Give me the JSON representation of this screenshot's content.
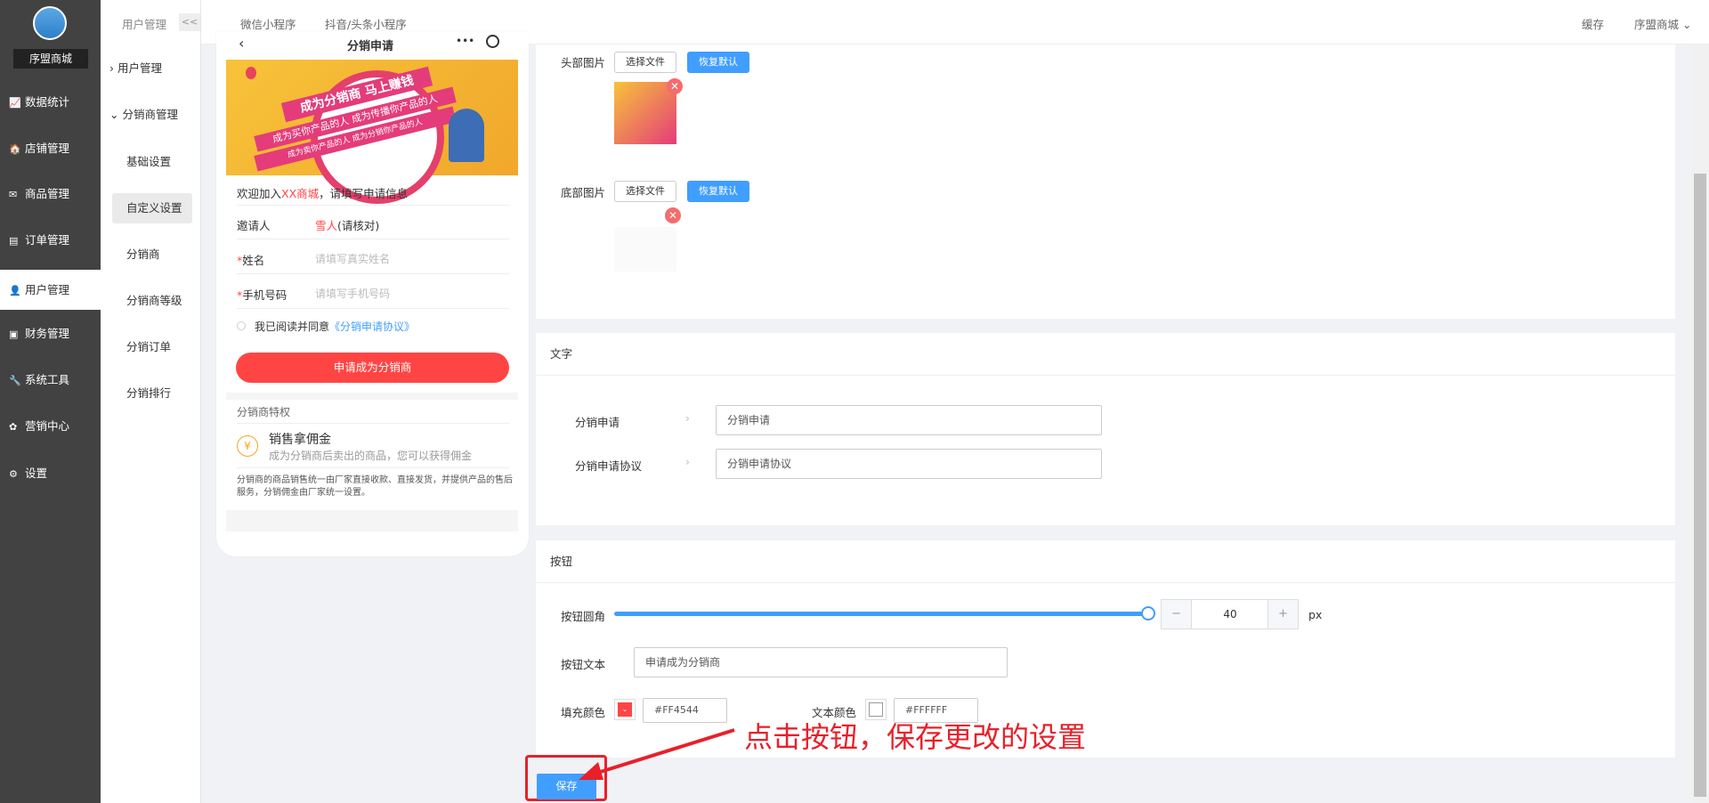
{
  "shop": {
    "name": "序盟商城"
  },
  "menu": [
    {
      "icon": "📈",
      "label": "数据统计"
    },
    {
      "icon": "🏠",
      "label": "店铺管理"
    },
    {
      "icon": "✉",
      "label": "商品管理"
    },
    {
      "icon": "▤",
      "label": "订单管理"
    },
    {
      "icon": "👤",
      "label": "用户管理"
    },
    {
      "icon": "▣",
      "label": "财务管理"
    },
    {
      "icon": "🔧",
      "label": "系统工具"
    },
    {
      "icon": "✿",
      "label": "营销中心"
    },
    {
      "icon": "⚙",
      "label": "设置"
    }
  ],
  "submenu": {
    "header": "用户管理",
    "collapse": "<<",
    "groups": [
      {
        "label": "用户管理"
      },
      {
        "label": "分销商管理"
      }
    ],
    "items": [
      "基础设置",
      "自定义设置",
      "分销商",
      "分销商等级",
      "分销订单",
      "分销排行"
    ]
  },
  "topbar": {
    "tabs": [
      "微信小程序",
      "抖音/头条小程序"
    ],
    "cache": "缓存",
    "shop": "序盟商城"
  },
  "phone": {
    "title": "分销申请",
    "banner_big": "成为分销商 马上赚钱",
    "ribbon1": "成为买你产品的人 成为传播你产品的人",
    "ribbon2": "成为卖你产品的人 成为分销你产品的人",
    "welcome_pre": "欢迎加入",
    "welcome_shop": "XX商城",
    "welcome_post": "，请填写申请信息",
    "inviter_label": "邀请人",
    "inviter_value": "雪人",
    "inviter_note": "(请核对)",
    "name_label": "姓名",
    "name_ph": "请填写真实姓名",
    "phone_label": "手机号码",
    "phone_ph": "请填写手机号码",
    "agree": "我已阅读并同意",
    "agreement": "《分销申请协议》",
    "apply_btn": "申请成为分销商",
    "privilege_title": "分销商特权",
    "priv_name": "销售拿佣金",
    "priv_desc": "成为分销商后卖出的商品，您可以获得佣金",
    "note": "分销商的商品销售统一由厂家直接收款、直接发货，并提供产品的售后服务，分销佣金由厂家统一设置。",
    "star": "*"
  },
  "images": {
    "head_label": "头部图片",
    "foot_label": "底部图片",
    "choose": "选择文件",
    "reset": "恢复默认",
    "x": "✕"
  },
  "text_section": {
    "title": "文字",
    "rows": [
      {
        "label": "分销申请",
        "value": "分销申请"
      },
      {
        "label": "分销申请协议",
        "value": "分销申请协议"
      }
    ]
  },
  "button_section": {
    "title": "按钮",
    "radius_label": "按钮圆角",
    "radius_value": "40",
    "radius_fraction": 1.0,
    "minus": "−",
    "plus": "+",
    "unit": "px",
    "text_label": "按钮文本",
    "text_value": "申请成为分销商",
    "fill_label": "填充颜色",
    "fill_value": "#FF4544",
    "textcolor_label": "文本颜色",
    "textcolor_value": "#FFFFFF"
  },
  "save": "保存",
  "annotation": "点击按钮，保存更改的设置",
  "colors": {
    "accent": "#409eff",
    "brand_red": "#ff4544",
    "annotation": "#e8202a"
  }
}
